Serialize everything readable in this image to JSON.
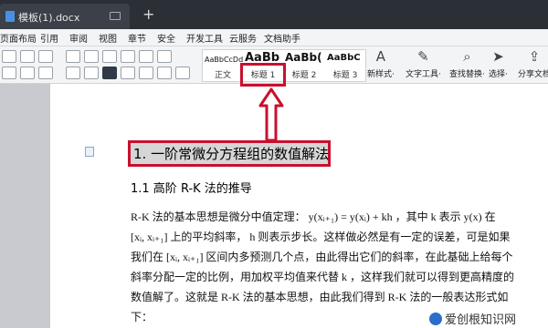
{
  "tabbar": {
    "tab_name": "模板(1).docx",
    "add": "+"
  },
  "menubar": {
    "items": [
      "页面布局",
      "引用",
      "审阅",
      "视图",
      "章节",
      "安全",
      "开发工具",
      "云服务",
      "文档助手"
    ]
  },
  "ribbon": {
    "styles": [
      {
        "preview": "AaBbCcDd",
        "label": "正文"
      },
      {
        "preview": "AaBb",
        "label": "标题 1"
      },
      {
        "preview": "AaBb(",
        "label": "标题 2"
      },
      {
        "preview": "AaBbC",
        "label": "标题 3"
      }
    ],
    "tools": [
      {
        "icon": "new-style-icon",
        "label": "新样式·"
      },
      {
        "icon": "text-tool-icon",
        "label": "文字工具·"
      },
      {
        "icon": "find-replace-icon",
        "label": "查找替换·"
      },
      {
        "icon": "select-icon",
        "label": "选择·"
      },
      {
        "icon": "share-icon",
        "label": "分享文档"
      }
    ]
  },
  "document": {
    "heading1": "1. 一阶常微分方程组的数值解法",
    "heading2": "1.1 高阶 R-K 法的推导",
    "lines": [
      "R-K 法的基本思想是微分中值定理： y(xᵢ₊₁) = y(xᵢ) + kh ，其中 k 表示 y(x) 在",
      "[xᵢ, xᵢ₊₁] 上的平均斜率， h 则表示步长。这样做必然是有一定的误差，可是如果",
      "我们在 [xᵢ, xᵢ₊₁] 区间内多预测几个点，由此得出它们的斜率，在此基础上给每个",
      "斜率分配一定的比例，用加权平均值来代替 k ，这样我们就可以得到更高精度的",
      "数值解了。这就是 R-K 法的基本思想，由此我们得到 R-K 法的一般表达形式如",
      "下："
    ]
  },
  "watermark": "爱创根知识网",
  "colors": {
    "highlight": "#c8102e"
  }
}
